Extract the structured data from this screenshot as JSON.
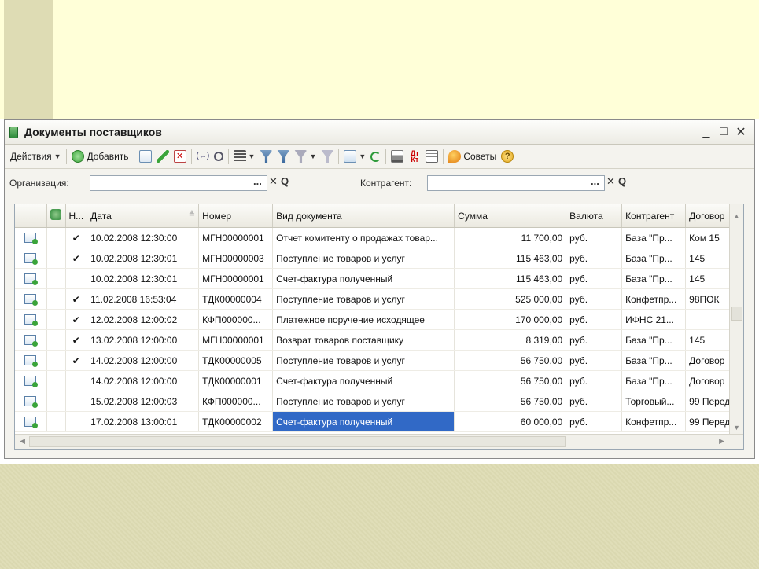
{
  "window": {
    "title": "Документы поставщиков",
    "controls": [
      "_",
      "□",
      "✕"
    ]
  },
  "toolbar": {
    "actions_label": "Действия",
    "add_label": "Добавить",
    "tips_label": "Советы"
  },
  "filters": {
    "org_label": "Организация:",
    "org_value": "",
    "counterparty_label": "Контрагент:",
    "counterparty_value": "",
    "select_btn": "...",
    "clear_btn": "✕",
    "search_btn": "Q"
  },
  "table": {
    "columns": [
      "",
      "",
      "Н...",
      "Дата",
      "Номер",
      "Вид документа",
      "Сумма",
      "Валюта",
      "Контрагент",
      "Договор"
    ],
    "rows": [
      {
        "posted": "✔",
        "date": "10.02.2008 12:30:00",
        "number": "МГН00000001",
        "kind": "Отчет комитенту о продажах товар...",
        "sum": "11 700,00",
        "currency": "руб.",
        "counterparty": "База \"Пр...",
        "contract": "Ком 15"
      },
      {
        "posted": "✔",
        "date": "10.02.2008 12:30:01",
        "number": "МГН00000003",
        "kind": "Поступление товаров и услуг",
        "sum": "115 463,00",
        "currency": "руб.",
        "counterparty": "База \"Пр...",
        "contract": "145"
      },
      {
        "posted": "",
        "date": "10.02.2008 12:30:01",
        "number": "МГН00000001",
        "kind": "Счет-фактура полученный",
        "sum": "115 463,00",
        "currency": "руб.",
        "counterparty": "База \"Пр...",
        "contract": "145"
      },
      {
        "posted": "✔",
        "date": "11.02.2008 16:53:04",
        "number": "ТДК00000004",
        "kind": "Поступление товаров и услуг",
        "sum": "525 000,00",
        "currency": "руб.",
        "counterparty": "Конфетпр...",
        "contract": "98ПОК"
      },
      {
        "posted": "✔",
        "date": "12.02.2008 12:00:02",
        "number": "КФП000000...",
        "kind": "Платежное поручение исходящее",
        "sum": "170 000,00",
        "currency": "руб.",
        "counterparty": "ИФНС 21...",
        "contract": ""
      },
      {
        "posted": "✔",
        "date": "13.02.2008 12:00:00",
        "number": "МГН00000001",
        "kind": "Возврат товаров поставщику",
        "sum": "8 319,00",
        "currency": "руб.",
        "counterparty": "База \"Пр...",
        "contract": "145"
      },
      {
        "posted": "✔",
        "date": "14.02.2008 12:00:00",
        "number": "ТДК00000005",
        "kind": "Поступление товаров и услуг",
        "sum": "56 750,00",
        "currency": "руб.",
        "counterparty": "База \"Пр...",
        "contract": "Договор"
      },
      {
        "posted": "",
        "date": "14.02.2008 12:00:00",
        "number": "ТДК00000001",
        "kind": "Счет-фактура полученный",
        "sum": "56 750,00",
        "currency": "руб.",
        "counterparty": "База \"Пр...",
        "contract": "Договор"
      },
      {
        "posted": "",
        "date": "15.02.2008 12:00:03",
        "number": "КФП000000...",
        "kind": "Поступление товаров и услуг",
        "sum": "56 750,00",
        "currency": "руб.",
        "counterparty": "Торговый...",
        "contract": "99 Перед"
      },
      {
        "posted": "",
        "date": "17.02.2008 13:00:01",
        "number": "ТДК00000002",
        "kind": "Счет-фактура полученный",
        "sum": "60 000,00",
        "currency": "руб.",
        "counterparty": "Конфетпр...",
        "contract": "99 Перед"
      }
    ],
    "selected_row": 9
  },
  "colors": {
    "selection": "#3169c6",
    "slide_top": "#ffffd8",
    "slide_accent": "#dedcb4"
  }
}
